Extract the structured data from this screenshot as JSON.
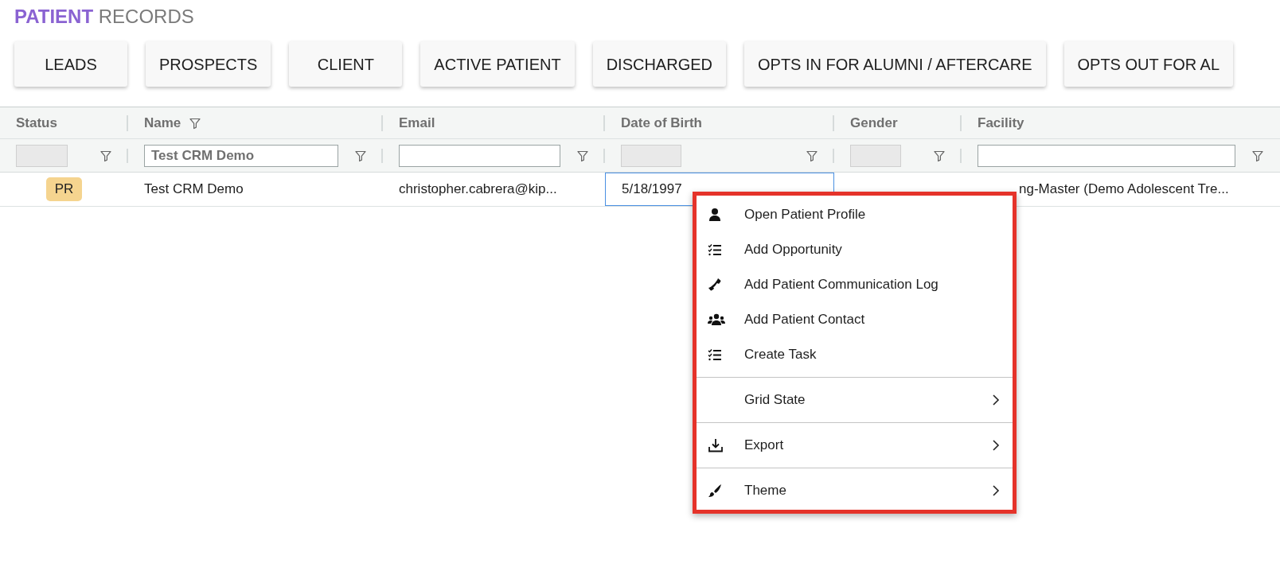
{
  "title": {
    "bold": "PATIENT",
    "rest": "RECORDS"
  },
  "stage_buttons": [
    "LEADS",
    "PROSPECTS",
    "CLIENT",
    "ACTIVE PATIENT",
    "DISCHARGED",
    "OPTS IN FOR ALUMNI / AFTERCARE",
    "OPTS OUT FOR AL"
  ],
  "table": {
    "columns": [
      {
        "label": "Status",
        "filtered": false,
        "filter_disabled": true
      },
      {
        "label": "Name",
        "filtered": true,
        "filter_disabled": false,
        "filter_value": "Test CRM Demo"
      },
      {
        "label": "Email",
        "filtered": false,
        "filter_disabled": false
      },
      {
        "label": "Date of Birth",
        "filtered": false,
        "filter_disabled": true
      },
      {
        "label": "Gender",
        "filtered": false,
        "filter_disabled": true
      },
      {
        "label": "Facility",
        "filtered": false,
        "filter_disabled": false
      }
    ],
    "rows": [
      {
        "cells": [
          {
            "text": "PR",
            "focused": false
          },
          {
            "text": "Test CRM Demo",
            "focused": false
          },
          {
            "text": "christopher.cabrera@kip...",
            "focused": false
          },
          {
            "text": "5/18/1997",
            "focused": true
          },
          {
            "focused": false
          },
          {
            "text": "ng-Master (Demo Adolescent Tre...",
            "focused": false
          }
        ]
      }
    ]
  },
  "context_menu": {
    "items": [
      {
        "kind": "action",
        "label": "Open Patient Profile"
      },
      {
        "kind": "action",
        "label": "Add Opportunity"
      },
      {
        "kind": "action",
        "label": "Add Patient Communication Log"
      },
      {
        "kind": "action",
        "label": "Add Patient Contact"
      },
      {
        "kind": "action",
        "label": "Create Task"
      },
      {
        "kind": "separator"
      },
      {
        "kind": "submenu",
        "label": "Grid State"
      },
      {
        "kind": "separator"
      },
      {
        "kind": "submenu",
        "label": "Export"
      },
      {
        "kind": "separator"
      },
      {
        "kind": "submenu",
        "label": "Theme"
      }
    ]
  }
}
